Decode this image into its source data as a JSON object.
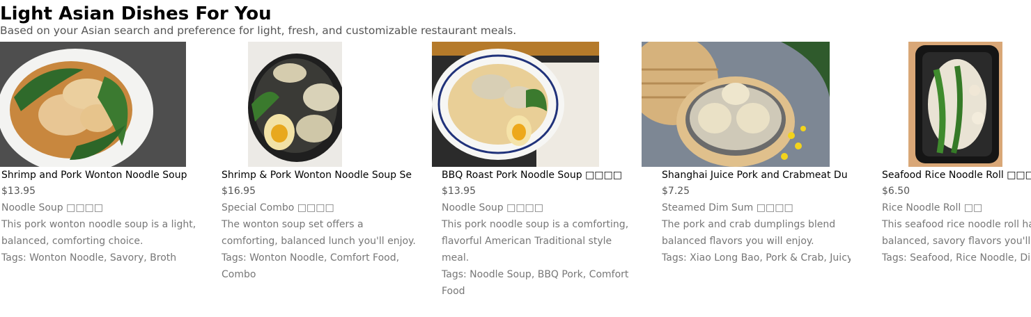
{
  "header": {
    "title": "Light Asian Dishes For You",
    "subtitle": "Based on your Asian search and preference for light, fresh, and customizable restaurant meals."
  },
  "cards": [
    {
      "name": "Shrimp and Pork Wonton Noodle Soup",
      "price": "$13.95",
      "category": "Noodle Soup □□□□",
      "description": "This pork wonton noodle soup is a light, balanced, comforting choice.",
      "tags": "Tags: Wonton Noodle, Savory, Broth",
      "image_icon": "wonton-soup-photo"
    },
    {
      "name": "Shrimp & Pork Wonton Noodle Soup Se",
      "price": "$16.95",
      "category": "Special Combo □□□□",
      "description": "The wonton soup set offers a comforting, balanced lunch you'll enjoy.",
      "tags": "Tags: Wonton Noodle, Comfort Food, Combo",
      "image_icon": "wonton-bowl-photo"
    },
    {
      "name": "BBQ Roast Pork Noodle Soup □□□□",
      "price": "$13.95",
      "category": "Noodle Soup □□□□",
      "description": "This pork noodle soup is a comforting, flavorful American Traditional style meal.",
      "tags": "Tags: Noodle Soup, BBQ Pork, Comfort Food",
      "image_icon": "bbq-pork-noodle-photo"
    },
    {
      "name": "Shanghai Juice Pork and Crabmeat Du",
      "price": "$7.25",
      "category": "Steamed Dim Sum □□□□",
      "description": "The pork and crab dumplings blend balanced flavors you will enjoy.",
      "tags": "Tags: Xiao Long Bao, Pork & Crab, Juicy",
      "image_icon": "dumpling-steamer-photo"
    },
    {
      "name": "Seafood Rice Noodle Roll □□□□",
      "price": "$6.50",
      "category": "Rice Noodle Roll □□",
      "description": "This seafood rice noodle roll has balanced, savory flavors you'll",
      "tags": "Tags: Seafood, Rice Noodle, Di",
      "image_icon": "rice-noodle-roll-photo"
    }
  ]
}
